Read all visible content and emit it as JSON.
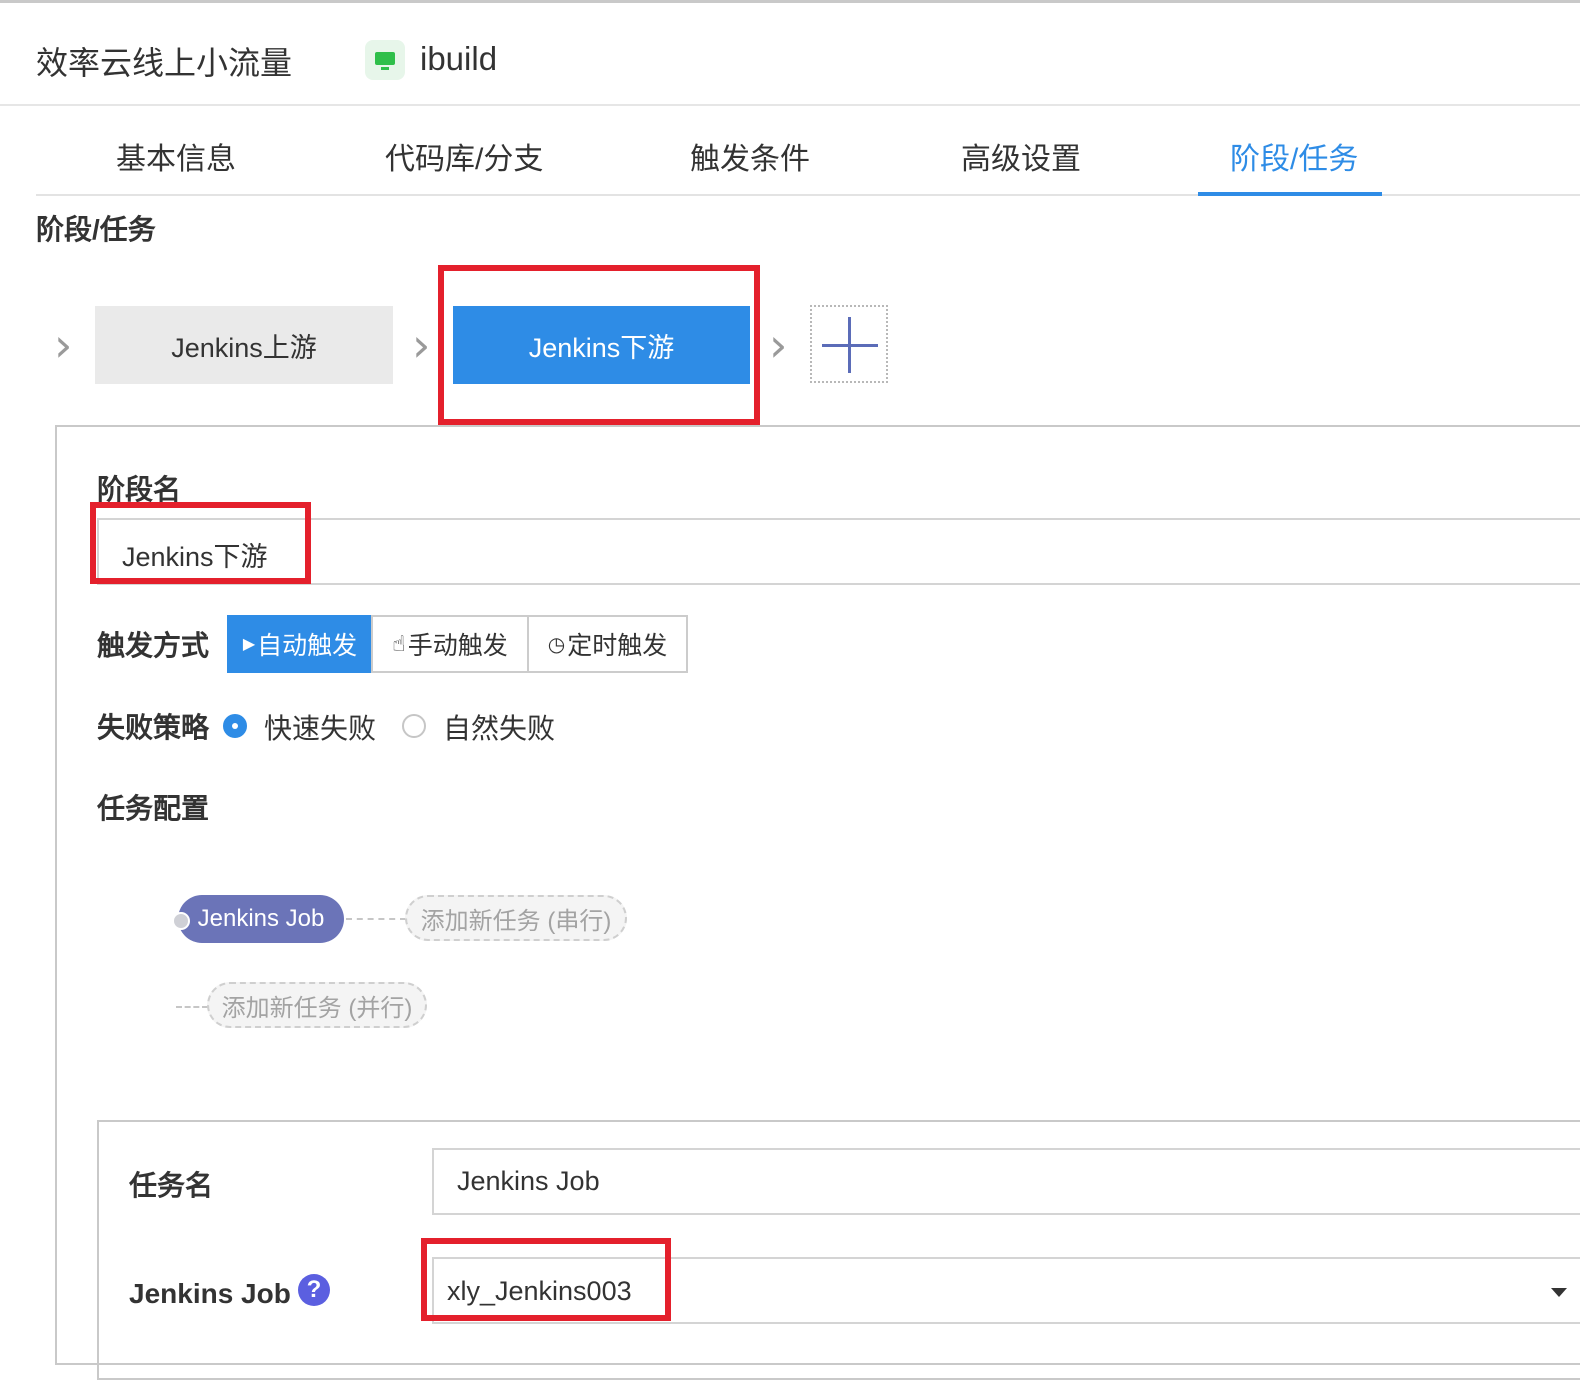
{
  "header": {
    "project_name": "效率云线上小流量",
    "env_name": "ibuild"
  },
  "tabs": [
    {
      "label": "基本信息"
    },
    {
      "label": "代码库/分支"
    },
    {
      "label": "触发条件"
    },
    {
      "label": "高级设置"
    },
    {
      "label": "阶段/任务",
      "active": true
    }
  ],
  "section": {
    "title": "阶段/任务"
  },
  "stages": [
    {
      "name": "Jenkins上游"
    },
    {
      "name": "Jenkins下游",
      "selected": true
    }
  ],
  "stage_form": {
    "name_label": "阶段名",
    "name_value": "Jenkins下游",
    "trigger_label": "触发方式",
    "trigger_options": [
      "自动触发",
      "手动触发",
      "定时触发"
    ],
    "trigger_selected": "自动触发",
    "failure_label": "失败策略",
    "failure_options": [
      "快速失败",
      "自然失败"
    ],
    "failure_selected": "快速失败",
    "task_config_label": "任务配置"
  },
  "task_flow": {
    "job_label": "Jenkins Job",
    "add_serial": "添加新任务 (串行)",
    "add_parallel": "添加新任务 (并行)"
  },
  "task_form": {
    "task_name_label": "任务名",
    "task_name_value": "Jenkins Job",
    "jenkins_job_label": "Jenkins Job",
    "jenkins_job_value": "xly_Jenkins003"
  },
  "icons": {
    "env": "monitor-icon",
    "help": "question-circle-icon",
    "hand": "hand-pointer-icon",
    "clock": "clock-icon",
    "play": "play-icon"
  },
  "colors": {
    "accent": "#2e8ce6",
    "highlight": "#e4202c",
    "task_pill": "#6b74b8"
  }
}
